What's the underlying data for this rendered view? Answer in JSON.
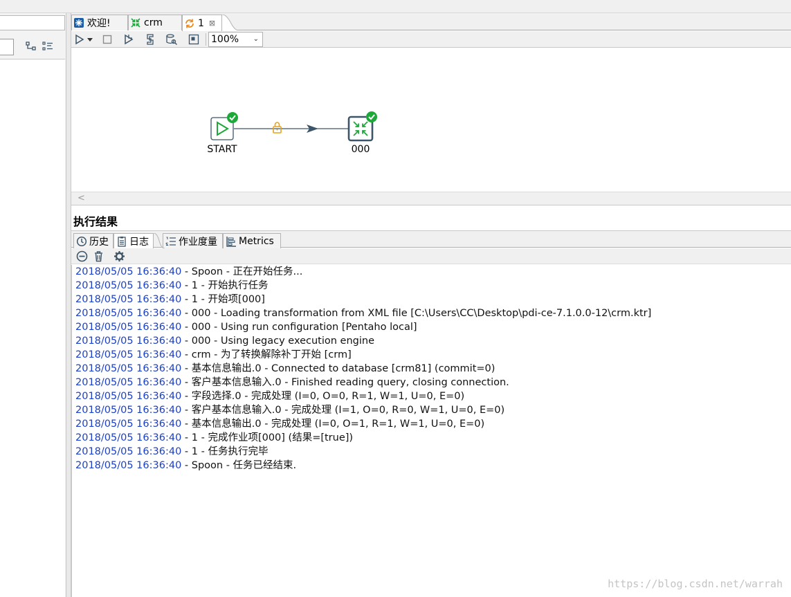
{
  "tabs": [
    {
      "label": "欢迎!",
      "icon": "welcome-icon"
    },
    {
      "label": "crm",
      "icon": "transformation-icon"
    },
    {
      "label": "1",
      "icon": "job-icon",
      "close": "⊠",
      "active": true
    }
  ],
  "toolbar": {
    "zoom": "100%"
  },
  "canvas": {
    "nodes": [
      {
        "label": "START"
      },
      {
        "label": "000"
      }
    ]
  },
  "results": {
    "title": "执行结果",
    "tabs": [
      {
        "label": "历史",
        "icon": "clock-icon"
      },
      {
        "label": "日志",
        "icon": "log-icon",
        "active": true
      },
      {
        "label": "作业度量",
        "icon": "list-numbered-icon"
      },
      {
        "label": "Metrics",
        "icon": "metrics-icon"
      }
    ],
    "log": [
      {
        "ts": "2018/05/05 16:36:40",
        "msg": " - Spoon - 正在开始任务..."
      },
      {
        "ts": "2018/05/05 16:36:40",
        "msg": " - 1 - 开始执行任务"
      },
      {
        "ts": "2018/05/05 16:36:40",
        "msg": " - 1 - 开始项[000]"
      },
      {
        "ts": "2018/05/05 16:36:40",
        "msg": " - 000 - Loading transformation from XML file [C:\\Users\\CC\\Desktop\\pdi-ce-7.1.0.0-12\\crm.ktr]"
      },
      {
        "ts": "2018/05/05 16:36:40",
        "msg": " - 000 - Using run configuration [Pentaho local]"
      },
      {
        "ts": "2018/05/05 16:36:40",
        "msg": " - 000 - Using legacy execution engine"
      },
      {
        "ts": "2018/05/05 16:36:40",
        "msg": " - crm - 为了转换解除补丁开始  [crm]"
      },
      {
        "ts": "2018/05/05 16:36:40",
        "msg": " - 基本信息输出.0 - Connected to database [crm81] (commit=0)"
      },
      {
        "ts": "2018/05/05 16:36:40",
        "msg": " - 客户基本信息输入.0 - Finished reading query, closing connection."
      },
      {
        "ts": "2018/05/05 16:36:40",
        "msg": " - 字段选择.0 - 完成处理 (I=0, O=0, R=1, W=1, U=0, E=0)"
      },
      {
        "ts": "2018/05/05 16:36:40",
        "msg": " - 客户基本信息输入.0 - 完成处理 (I=1, O=0, R=0, W=1, U=0, E=0)"
      },
      {
        "ts": "2018/05/05 16:36:40",
        "msg": " - 基本信息输出.0 - 完成处理 (I=0, O=1, R=1, W=1, U=0, E=0)"
      },
      {
        "ts": "2018/05/05 16:36:40",
        "msg": " - 1 - 完成作业项[000] (结果=[true])"
      },
      {
        "ts": "2018/05/05 16:36:40",
        "msg": " - 1 - 任务执行完毕"
      },
      {
        "ts": "2018/05/05 16:36:40",
        "msg": " - Spoon - 任务已经结束."
      }
    ]
  },
  "watermark": "https://blog.csdn.net/warrah",
  "colors": {
    "timestamp": "#1a3fc8",
    "success": "#1fa83a",
    "hop_lock": "#e8a317",
    "node_border": "#3d5568"
  }
}
